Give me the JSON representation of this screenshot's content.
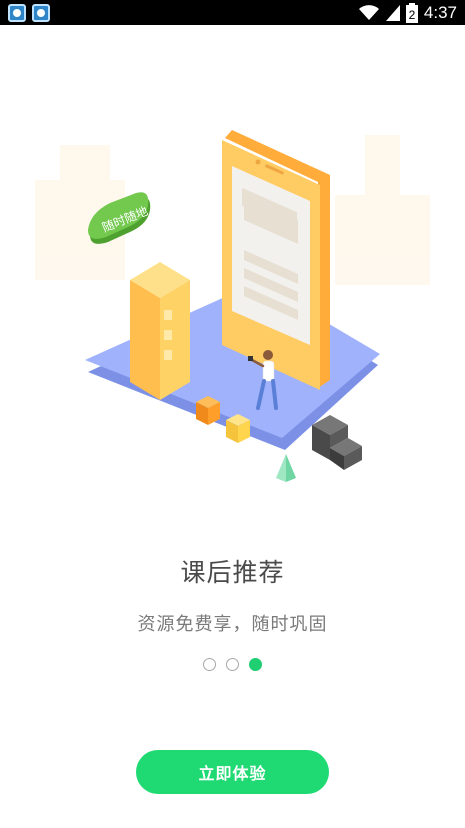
{
  "status_bar": {
    "time": "4:37",
    "icons": [
      "app-badge-icon",
      "app-badge-icon",
      "wifi-icon",
      "cellular-signal-icon",
      "battery-icon"
    ],
    "battery_level": "2"
  },
  "illustration": {
    "bubble_label": "随时随地",
    "colors": {
      "platform": "#8fa6f5",
      "phone": "#ffc64e",
      "building": "#ffcf5a",
      "cube": "#ff9f2a",
      "stairs": "#4a4a4a",
      "bubble": "#5fbf3f"
    }
  },
  "content": {
    "title": "课后推荐",
    "subtitle": "资源免费享，随时巩固"
  },
  "pager": {
    "total": 3,
    "current": 3
  },
  "cta": {
    "label": "立即体验",
    "color": "#1fda73"
  }
}
